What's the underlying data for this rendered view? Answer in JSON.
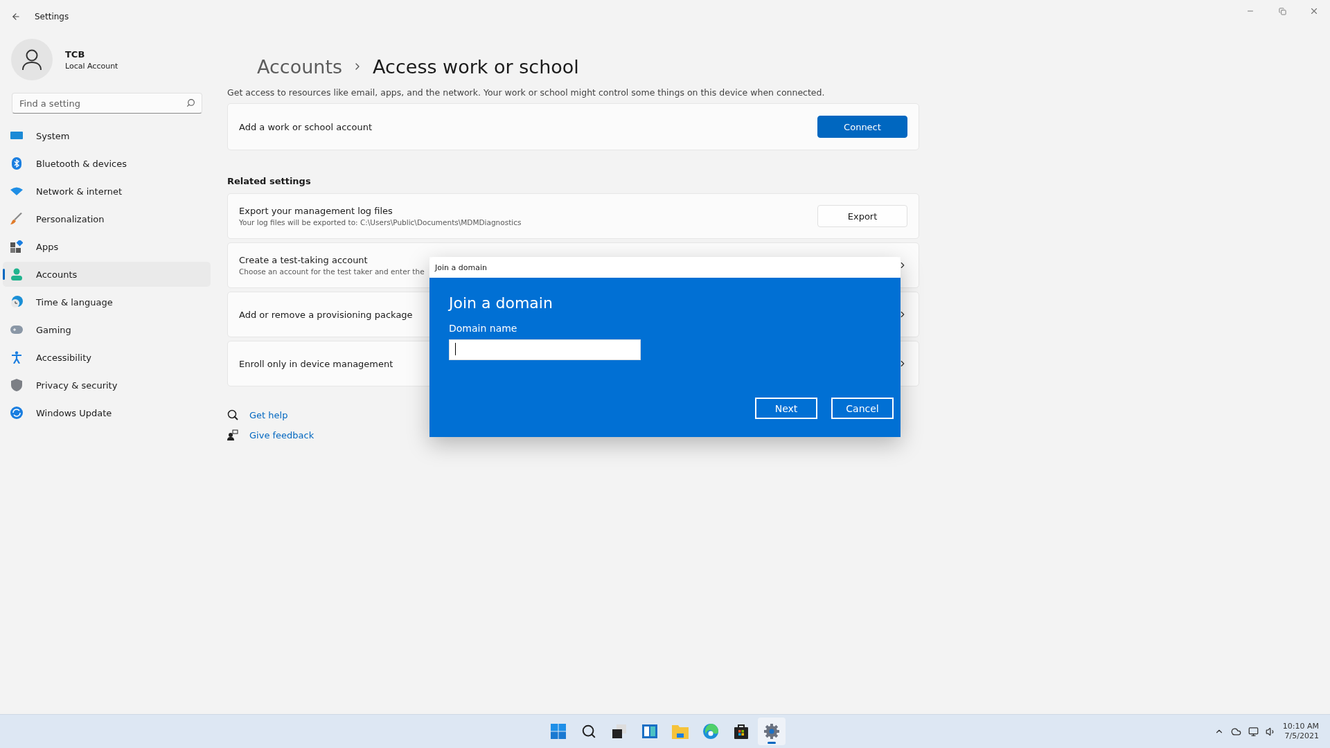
{
  "window": {
    "title": "Settings"
  },
  "profile": {
    "name": "TCB",
    "account_type": "Local Account"
  },
  "search": {
    "placeholder": "Find a setting"
  },
  "nav": [
    {
      "label": "System",
      "selected": false
    },
    {
      "label": "Bluetooth & devices",
      "selected": false
    },
    {
      "label": "Network & internet",
      "selected": false
    },
    {
      "label": "Personalization",
      "selected": false
    },
    {
      "label": "Apps",
      "selected": false
    },
    {
      "label": "Accounts",
      "selected": true
    },
    {
      "label": "Time & language",
      "selected": false
    },
    {
      "label": "Gaming",
      "selected": false
    },
    {
      "label": "Accessibility",
      "selected": false
    },
    {
      "label": "Privacy & security",
      "selected": false
    },
    {
      "label": "Windows Update",
      "selected": false
    }
  ],
  "breadcrumb": {
    "parent": "Accounts",
    "current": "Access work or school"
  },
  "description": "Get access to resources like email, apps, and the network. Your work or school might control some things on this device when connected.",
  "add_account": {
    "label": "Add a work or school account",
    "button": "Connect"
  },
  "related_settings": {
    "heading": "Related settings",
    "items": [
      {
        "kind": "button",
        "title": "Export your management log files",
        "subtitle": "Your log files will be exported to: C:\\Users\\Public\\Documents\\MDMDiagnostics",
        "button": "Export"
      },
      {
        "kind": "chevron",
        "title": "Create a test-taking account",
        "subtitle": "Choose an account for the test taker and enter the"
      },
      {
        "kind": "chevron",
        "title": "Add or remove a provisioning package"
      },
      {
        "kind": "chevron",
        "title": "Enroll only in device management"
      }
    ]
  },
  "help_links": [
    "Get help",
    "Give feedback"
  ],
  "dialog": {
    "title": "Join a domain",
    "heading": "Join a domain",
    "field_label": "Domain name",
    "buttons": [
      "Next",
      "Cancel"
    ]
  },
  "taskbar": {
    "apps": [
      {
        "selected": false
      },
      {
        "selected": false
      },
      {
        "selected": false
      },
      {
        "selected": false
      },
      {
        "selected": false
      },
      {
        "selected": false
      },
      {
        "selected": false
      },
      {
        "selected": true
      }
    ],
    "time": "10:10 AM",
    "date": "7/5/2021"
  }
}
